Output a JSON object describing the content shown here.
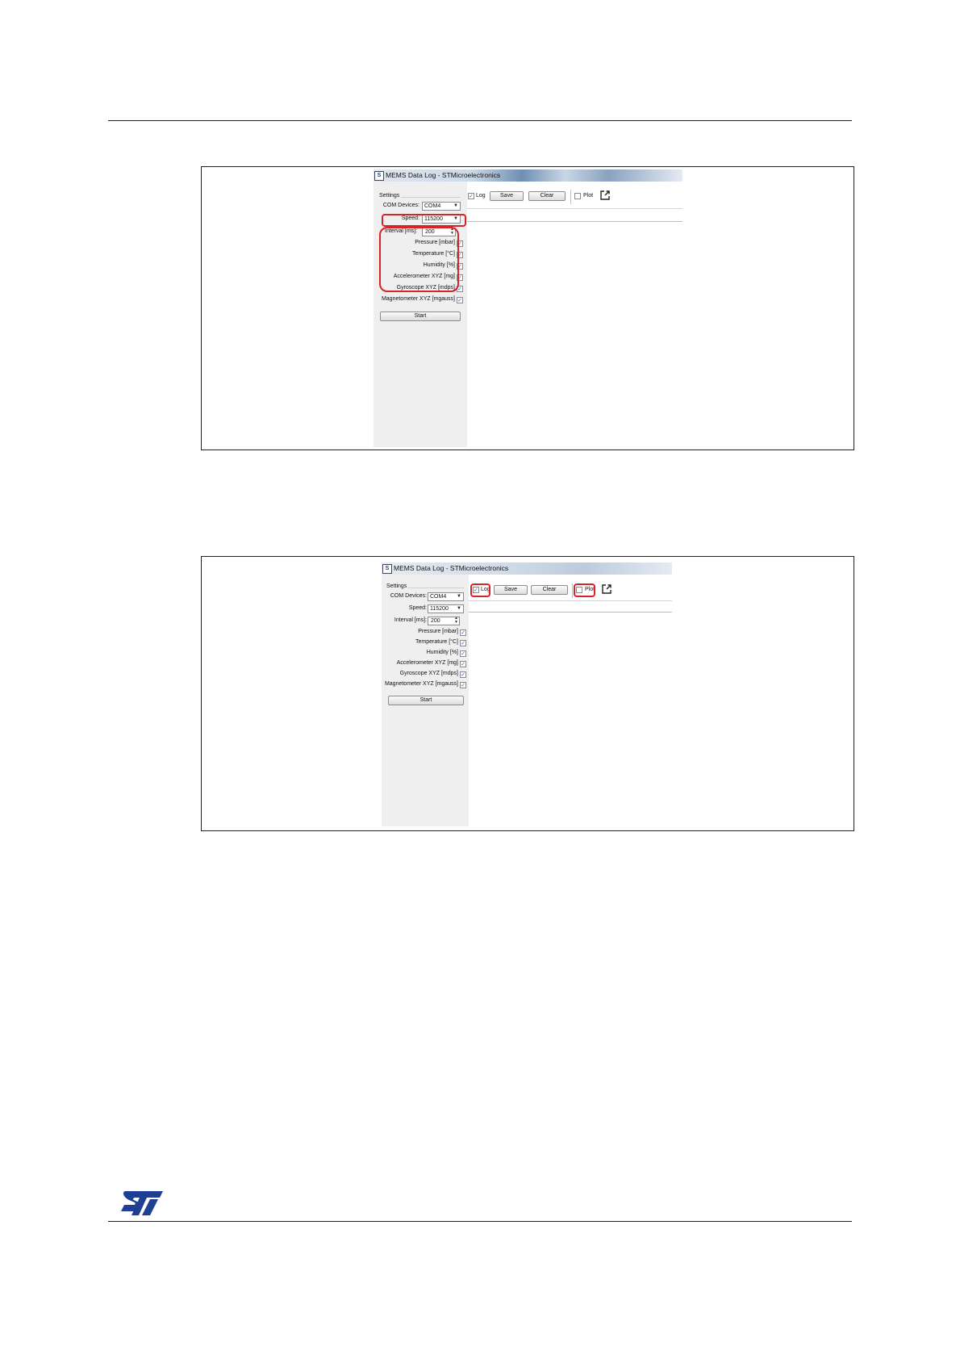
{
  "figures": [
    {
      "window_title": "MEMS Data Log - STMicroelectronics",
      "settings_label": "Settings",
      "com_devices_label": "COM Devices:",
      "com_devices_value": "COM4",
      "speed_label": "Speed:",
      "speed_value": "115200",
      "interval_label": "Interval [ms]:",
      "interval_value": "200",
      "sensors": [
        {
          "label": "Pressure  [mbar]",
          "checked": true
        },
        {
          "label": "Temperature  [°C]",
          "checked": true
        },
        {
          "label": "Humidity  [%]",
          "checked": true
        },
        {
          "label": "Accelerometer XYZ  [mg]",
          "checked": true
        },
        {
          "label": "Gyroscope XYZ  [mdps]",
          "checked": true
        },
        {
          "label": "Magnetometer XYZ [mgauss]",
          "checked": true
        }
      ],
      "start_label": "Start",
      "log_label": "Log",
      "log_checked": true,
      "save_label": "Save",
      "clear_label": "Clear",
      "plot_label": "Plot",
      "plot_checked": false,
      "highlight_color": "#d8232a"
    },
    {
      "window_title": "MEMS Data Log - STMicroelectronics",
      "settings_label": "Settings",
      "com_devices_label": "COM Devices:",
      "com_devices_value": "COM4",
      "speed_label": "Speed:",
      "speed_value": "115200",
      "interval_label": "Interval [ms]:",
      "interval_value": "200",
      "sensors": [
        {
          "label": "Pressure  [mbar]",
          "checked": true
        },
        {
          "label": "Temperature  [°C]",
          "checked": true
        },
        {
          "label": "Humidity  [%]",
          "checked": true
        },
        {
          "label": "Accelerometer XYZ  [mg]",
          "checked": true
        },
        {
          "label": "Gyroscope XYZ  [mdps]",
          "checked": true
        },
        {
          "label": "Magnetometer XYZ [mgauss]",
          "checked": true
        }
      ],
      "start_label": "Start",
      "log_label": "Log",
      "log_checked": true,
      "save_label": "Save",
      "clear_label": "Clear",
      "plot_label": "Plot",
      "plot_checked": false,
      "highlight_color": "#d8232a"
    }
  ],
  "logo": {
    "text": "ST",
    "color": "#1d3f94"
  }
}
